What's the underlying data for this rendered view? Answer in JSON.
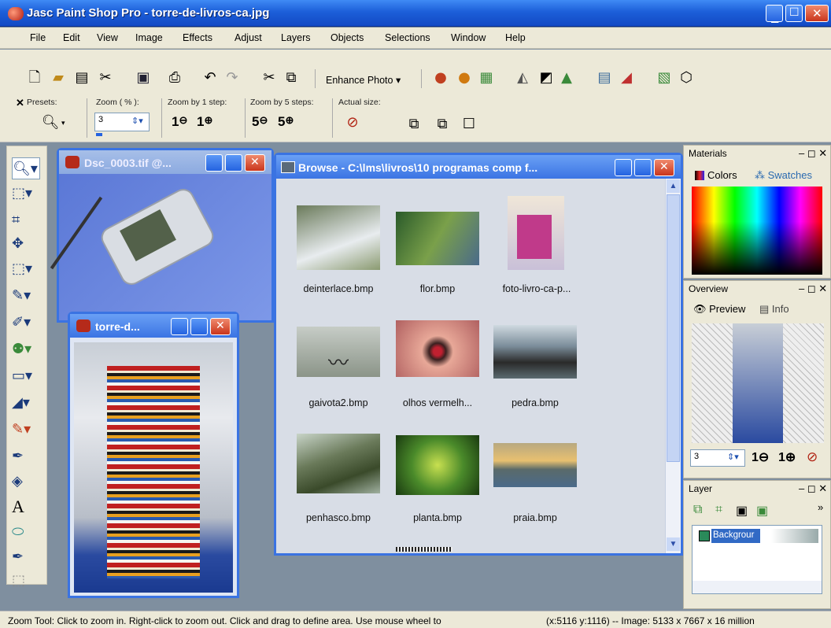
{
  "window": {
    "title": "Jasc Paint Shop Pro - torre-de-livros-ca.jpg"
  },
  "menu": [
    "File",
    "Edit",
    "View",
    "Image",
    "Effects",
    "Adjust",
    "Layers",
    "Objects",
    "Selections",
    "Window",
    "Help"
  ],
  "toolbar": {
    "enhance_photo": "Enhance Photo"
  },
  "tool_options": {
    "presets_label": "Presets:",
    "zoom_label": "Zoom ( % ):",
    "zoom_value": "3",
    "zoom_by_1_label": "Zoom by 1 step:",
    "zoom_by_5_label": "Zoom by 5 steps:",
    "actual_size_label": "Actual size:",
    "step1_digit": "1",
    "step5_digit": "5"
  },
  "windows": {
    "dsc": {
      "title": "Dsc_0003.tif @..."
    },
    "torre": {
      "title": "torre-d..."
    },
    "browse": {
      "title": "Browse - C:\\lms\\livros\\10 programas comp f...",
      "files": [
        {
          "name": "deinterlace.bmp"
        },
        {
          "name": "flor.bmp"
        },
        {
          "name": "foto-livro-ca-p..."
        },
        {
          "name": "gaivota2.bmp"
        },
        {
          "name": "olhos vermelh..."
        },
        {
          "name": "pedra.bmp"
        },
        {
          "name": "penhasco.bmp"
        },
        {
          "name": "planta.bmp"
        },
        {
          "name": "praia.bmp"
        }
      ]
    }
  },
  "panels": {
    "materials": {
      "title": "Materials",
      "tab_colors": "Colors",
      "tab_swatches": "Swatches"
    },
    "overview": {
      "title": "Overview",
      "tab_preview": "Preview",
      "tab_info": "Info",
      "zoom_value": "3"
    },
    "layer": {
      "title": "Layer",
      "layer_name": "Backgrour"
    }
  },
  "statusbar": {
    "hint": "Zoom Tool: Click to zoom in. Right-click to zoom out. Click and drag to define area. Use mouse wheel to",
    "info": "(x:5116 y:1116) -- Image:  5133 x 7667 x 16 million"
  },
  "colors": {
    "xp_blue": "#2563e0",
    "close_red": "#c9351c",
    "face": "#ece9d8",
    "workspace": "#7f8f9f"
  }
}
